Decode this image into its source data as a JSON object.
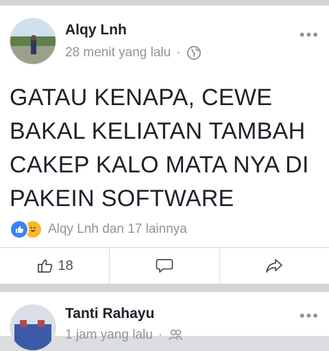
{
  "post1": {
    "author": "Alqy Lnh",
    "time": "28 menit yang lalu",
    "separator": "·",
    "privacy_icon": "globe-icon",
    "text": "GATAU KENAPA, CEWE BAKAL KELIATAN TAMBAH CAKEP KALO MATA NYA DI PAKEIN SOFTWARE",
    "reactions_text": "Alqy Lnh dan 17 lainnya",
    "like_count": "18"
  },
  "post2": {
    "author": "Tanti Rahayu",
    "time": "1 jam yang lalu",
    "separator": "·",
    "privacy_icon": "friends-icon"
  },
  "colors": {
    "accent_blue": "#3b82f6",
    "haha_yellow": "#f7b928",
    "muted_text": "#8d949e"
  }
}
